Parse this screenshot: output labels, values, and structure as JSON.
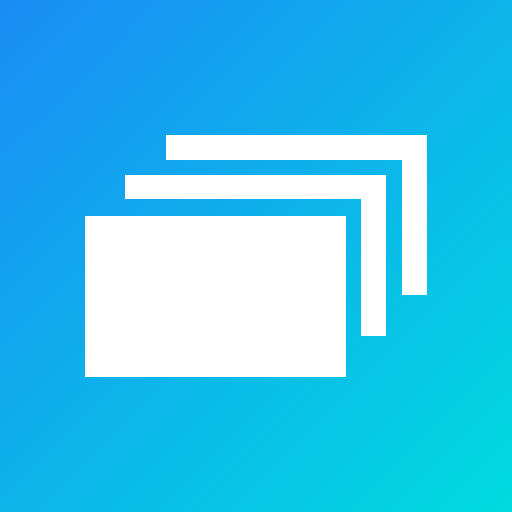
{
  "icon": {
    "name": "stacked-windows-icon",
    "background": {
      "gradient_start": "#1a8cf5",
      "gradient_end": "#00dbe0"
    },
    "foreground_color": "#ffffff"
  }
}
